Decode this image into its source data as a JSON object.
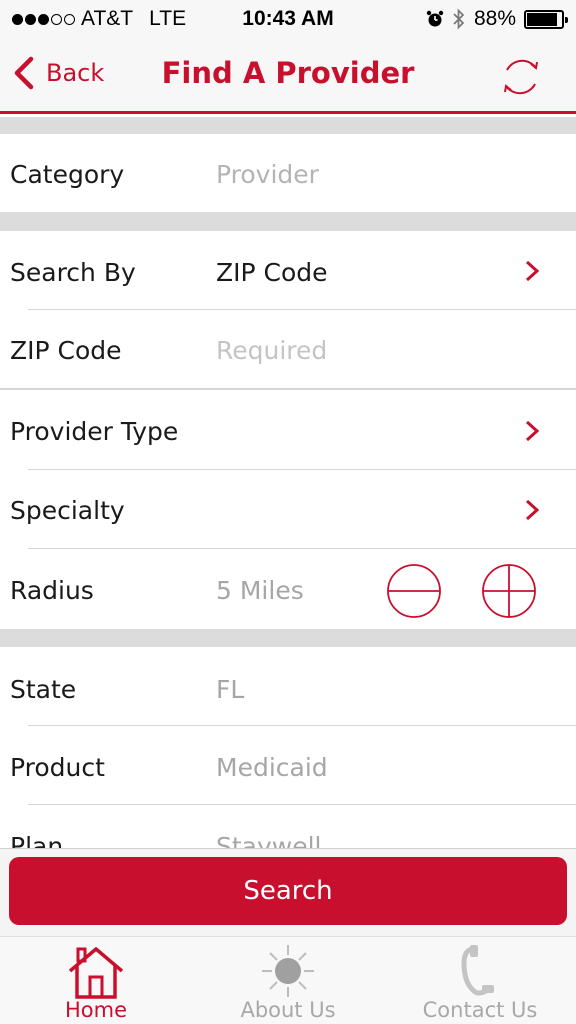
{
  "status_bar": {
    "carrier": "AT&T",
    "network": "LTE",
    "time": "10:43 AM",
    "battery_percent": "88%",
    "battery_level": 0.88,
    "signal_bars_filled": 3,
    "signal_bars_total": 5
  },
  "nav": {
    "back_label": "Back",
    "title": "Find A Provider",
    "refresh_icon": "refresh-icon"
  },
  "form": {
    "category": {
      "label": "Category",
      "value": "Provider"
    },
    "search_by": {
      "label": "Search By",
      "value": "ZIP Code"
    },
    "zip_code": {
      "label": "ZIP Code",
      "placeholder": "Required"
    },
    "provider_type": {
      "label": "Provider Type"
    },
    "specialty": {
      "label": "Specialty"
    },
    "radius": {
      "label": "Radius",
      "value": "5 Miles"
    },
    "state": {
      "label": "State",
      "value": "FL"
    },
    "product": {
      "label": "Product",
      "value": "Medicaid"
    },
    "plan": {
      "label": "Plan",
      "value": "Staywell"
    }
  },
  "search_button": {
    "label": "Search"
  },
  "tabs": [
    {
      "label": "Home",
      "icon": "home-icon",
      "active": true
    },
    {
      "label": "About Us",
      "icon": "sun-icon",
      "active": false
    },
    {
      "label": "Contact Us",
      "icon": "phone-icon",
      "active": false
    }
  ],
  "colors": {
    "brand_red": "#c8102e",
    "section_gap": "#dcdcdc",
    "placeholder_gray": "#b4b4b4"
  }
}
